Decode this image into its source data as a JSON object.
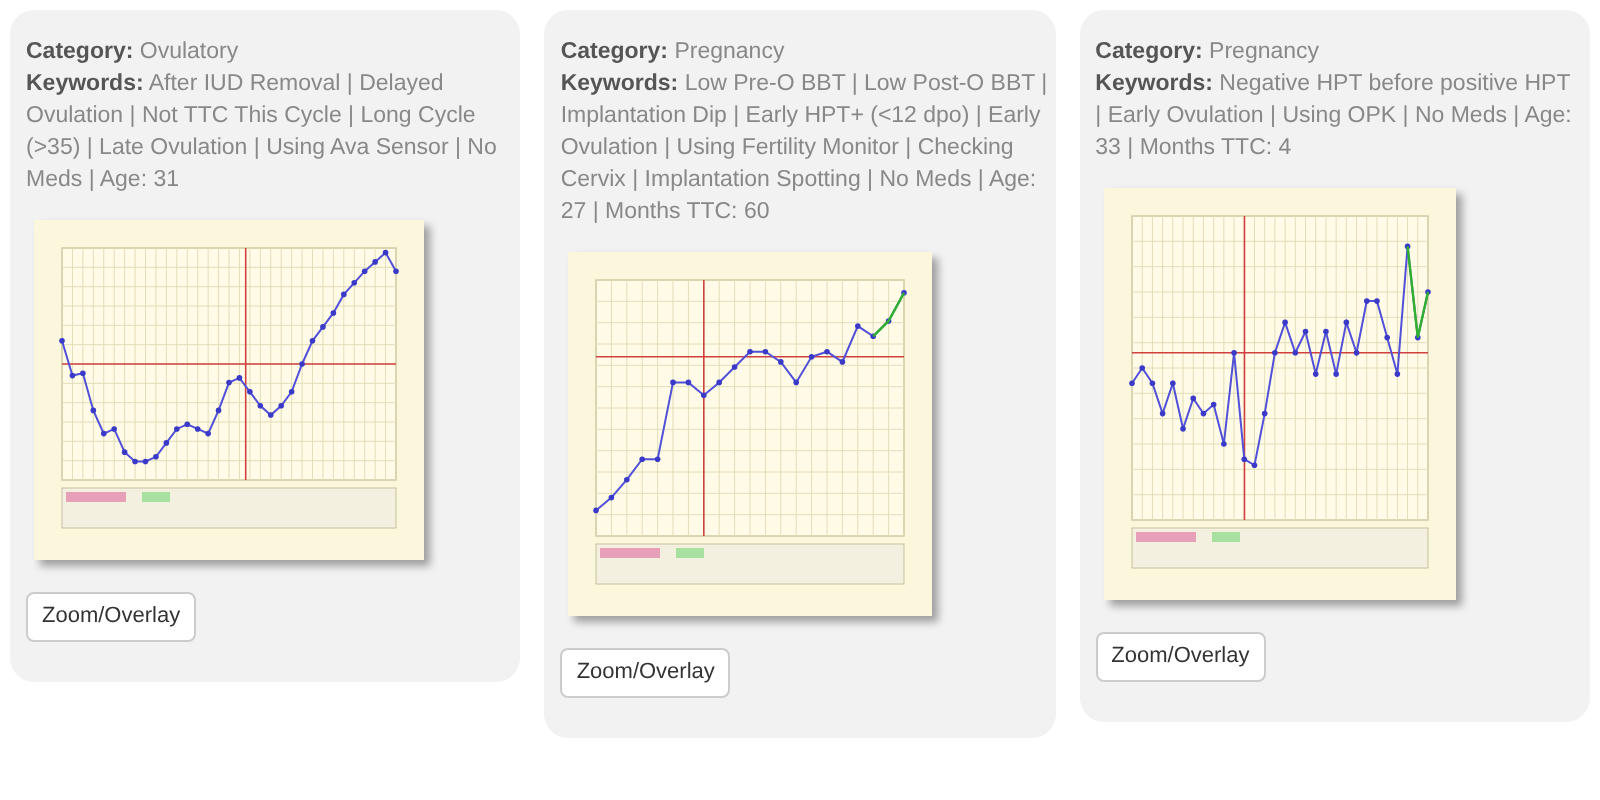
{
  "cards": [
    {
      "category_label": "Category:",
      "category": "Ovulatory",
      "keywords_label": "Keywords:",
      "keywords": "After IUD Removal | Delayed Ovulation | Not TTC This Cycle | Long Cycle (>35) | Late Ovulation | Using Ava Sensor | No Meds | Age: 31",
      "button": "Zoom/Overlay"
    },
    {
      "category_label": "Category:",
      "category": "Pregnancy",
      "keywords_label": "Keywords:",
      "keywords": "Low Pre-O BBT | Low Post-O BBT | Implantation Dip | Early HPT+ (<12 dpo) | Early Ovulation | Using Fertility Monitor | Checking Cervix | Implantation Spotting | No Meds | Age: 27 | Months TTC: 60",
      "button": "Zoom/Overlay"
    },
    {
      "category_label": "Category:",
      "category": "Pregnancy",
      "keywords_label": "Keywords:",
      "keywords": "Negative HPT before positive HPT | Early Ovulation | Using OPK | No Meds | Age: 33 | Months TTC: 4",
      "button": "Zoom/Overlay"
    }
  ]
}
